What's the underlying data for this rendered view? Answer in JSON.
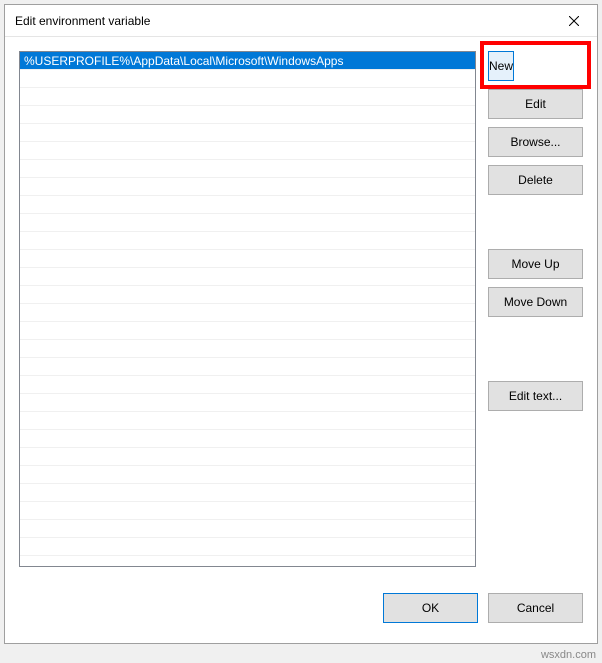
{
  "dialog": {
    "title": "Edit environment variable"
  },
  "list": {
    "items": [
      "%USERPROFILE%\\AppData\\Local\\Microsoft\\WindowsApps"
    ],
    "selected_index": 0
  },
  "buttons": {
    "new": "New",
    "edit": "Edit",
    "browse": "Browse...",
    "delete": "Delete",
    "move_up": "Move Up",
    "move_down": "Move Down",
    "edit_text": "Edit text...",
    "ok": "OK",
    "cancel": "Cancel"
  },
  "watermark": "wsxdn.com",
  "highlight": {
    "target": "new-button"
  }
}
